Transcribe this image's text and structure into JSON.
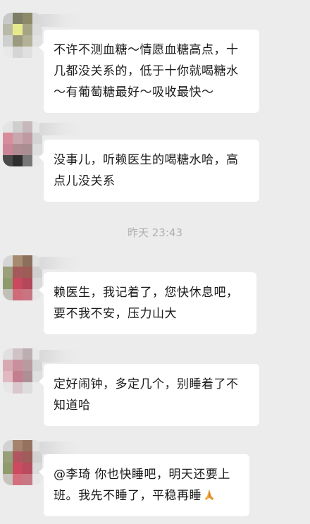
{
  "messages": [
    {
      "text": "不许不测血糖～情愿血糖高点，十几都没关系的，低于十你就喝糖水～有葡萄糖最好～吸收最快～",
      "emoji": ""
    },
    {
      "text": "没事儿，听赖医生的喝糖水哈，高点儿没关系",
      "emoji": ""
    },
    {
      "text": "赖医生，我记着了，您快休息吧，要不我不安，压力山大",
      "emoji": ""
    },
    {
      "text": "定好闹钟，多定几个，别睡着了不知道哈",
      "emoji": ""
    },
    {
      "text": "@李琦 你也快睡吧，明天还要上班。我先不睡了，平稳再睡",
      "emoji": "praying-hands-icon"
    }
  ],
  "timestamp": "昨天 23:43",
  "colors": {
    "background": "#ececec",
    "bubble": "#ffffff",
    "text": "#1a1a1a",
    "timestamp": "#b0b0b0"
  }
}
